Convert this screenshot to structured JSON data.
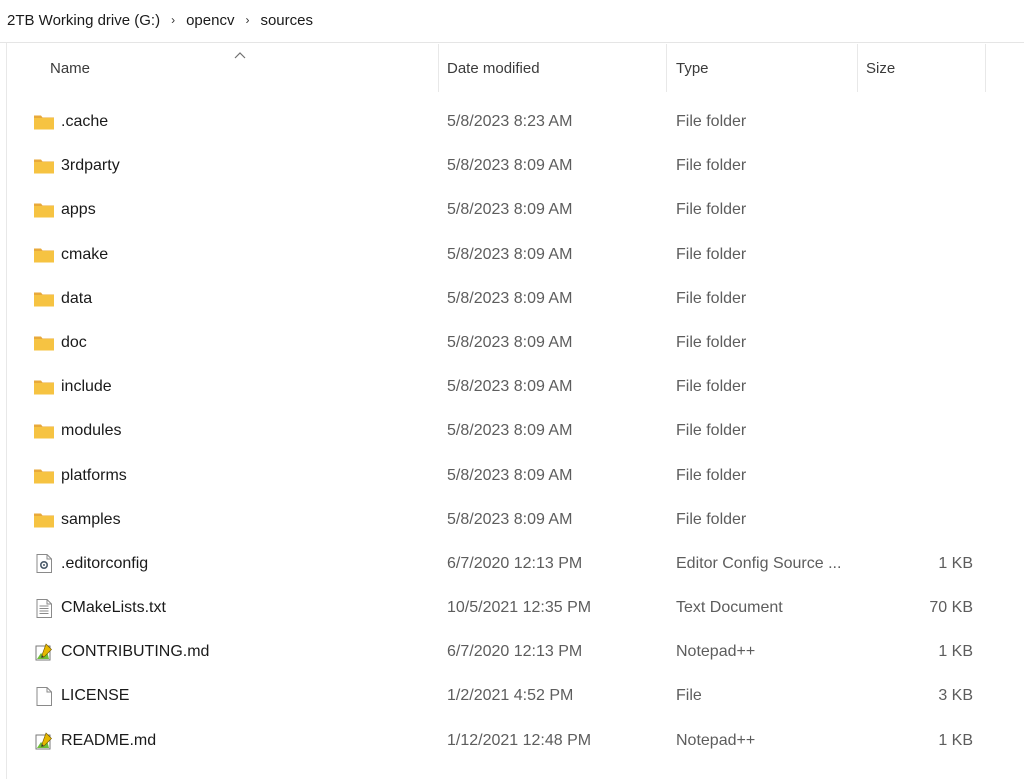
{
  "breadcrumb": {
    "items": [
      "2TB Working drive (G:)",
      "opencv",
      "sources"
    ],
    "separator": "›"
  },
  "columns": {
    "name": "Name",
    "date": "Date modified",
    "type": "Type",
    "size": "Size",
    "sort_indicator": "^"
  },
  "files": [
    {
      "name": ".cache",
      "date": "5/8/2023 8:23 AM",
      "type": "File folder",
      "size": "",
      "icon": "folder-icon"
    },
    {
      "name": "3rdparty",
      "date": "5/8/2023 8:09 AM",
      "type": "File folder",
      "size": "",
      "icon": "folder-icon"
    },
    {
      "name": "apps",
      "date": "5/8/2023 8:09 AM",
      "type": "File folder",
      "size": "",
      "icon": "folder-icon"
    },
    {
      "name": "cmake",
      "date": "5/8/2023 8:09 AM",
      "type": "File folder",
      "size": "",
      "icon": "folder-icon"
    },
    {
      "name": "data",
      "date": "5/8/2023 8:09 AM",
      "type": "File folder",
      "size": "",
      "icon": "folder-icon"
    },
    {
      "name": "doc",
      "date": "5/8/2023 8:09 AM",
      "type": "File folder",
      "size": "",
      "icon": "folder-icon"
    },
    {
      "name": "include",
      "date": "5/8/2023 8:09 AM",
      "type": "File folder",
      "size": "",
      "icon": "folder-icon"
    },
    {
      "name": "modules",
      "date": "5/8/2023 8:09 AM",
      "type": "File folder",
      "size": "",
      "icon": "folder-icon"
    },
    {
      "name": "platforms",
      "date": "5/8/2023 8:09 AM",
      "type": "File folder",
      "size": "",
      "icon": "folder-icon"
    },
    {
      "name": "samples",
      "date": "5/8/2023 8:09 AM",
      "type": "File folder",
      "size": "",
      "icon": "folder-icon"
    },
    {
      "name": ".editorconfig",
      "date": "6/7/2020 12:13 PM",
      "type": "Editor Config Source ...",
      "size": "1 KB",
      "icon": "config-file-icon"
    },
    {
      "name": "CMakeLists.txt",
      "date": "10/5/2021 12:35 PM",
      "type": "Text Document",
      "size": "70 KB",
      "icon": "text-file-icon"
    },
    {
      "name": "CONTRIBUTING.md",
      "date": "6/7/2020 12:13 PM",
      "type": "Notepad++",
      "size": "1 KB",
      "icon": "notepadpp-file-icon"
    },
    {
      "name": "LICENSE",
      "date": "1/2/2021 4:52 PM",
      "type": "File",
      "size": "3 KB",
      "icon": "blank-file-icon"
    },
    {
      "name": "README.md",
      "date": "1/12/2021 12:48 PM",
      "type": "Notepad++",
      "size": "1 KB",
      "icon": "notepadpp-file-icon"
    }
  ],
  "colors": {
    "folder": "#f3c241",
    "folder_back": "#e8a93a",
    "divider": "#e5e5e5"
  }
}
